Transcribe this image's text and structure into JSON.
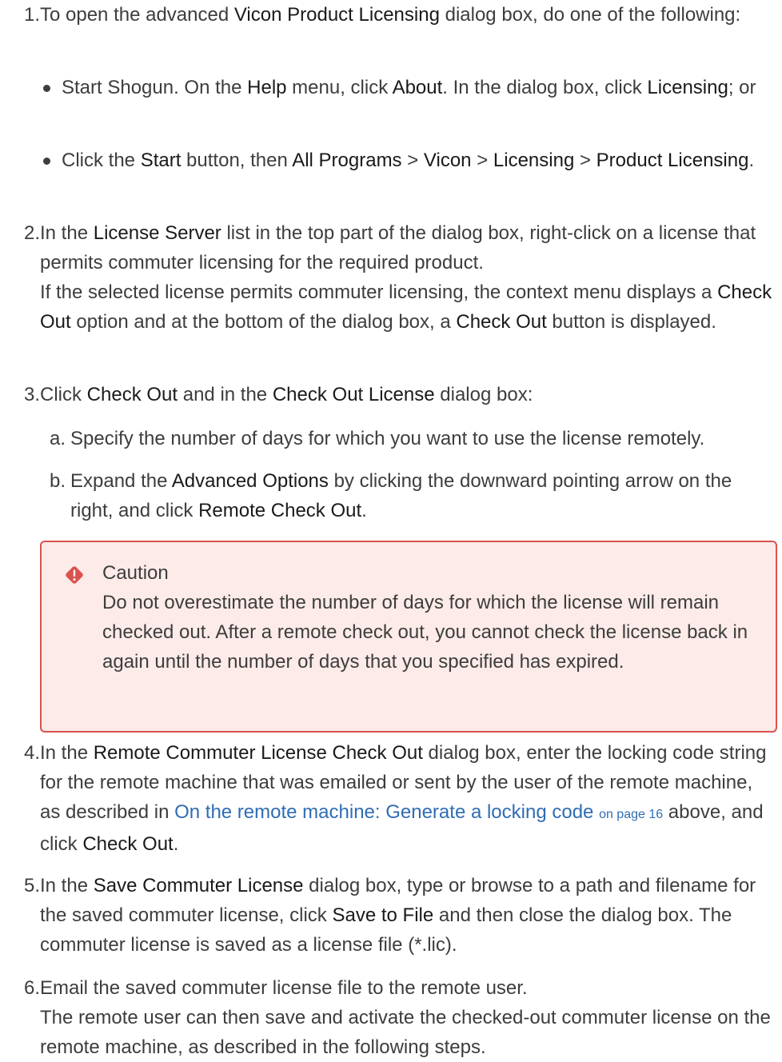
{
  "steps": [
    {
      "num": "1.",
      "parts": [
        "To open the advanced ",
        {
          "b": "Vicon Product Licensing"
        },
        " dialog box, do one of the following:"
      ]
    },
    {
      "num": "2.",
      "parts": [
        "In the ",
        {
          "b": "License Server"
        },
        " list in the top part of the dialog box, right-click on a license that permits commuter licensing for the required product.",
        {
          "br": true
        },
        "If the selected license permits commuter licensing, the context menu displays a ",
        {
          "b": "Check Out"
        },
        " option and at the bottom of the dialog box, a ",
        {
          "b": "Check Out"
        },
        " button is displayed."
      ]
    },
    {
      "num": "3.",
      "parts": [
        "Click ",
        {
          "b": "Check Out"
        },
        " and in the ",
        {
          "b": "Check Out License"
        },
        " dialog box:"
      ]
    },
    {
      "num": "4.",
      "parts": [
        "In the ",
        {
          "b": "Remote Commuter License Check Out"
        },
        " dialog box, enter the locking code string for the remote machine that was emailed or sent by the user of the remote machine, as described in ",
        {
          "link": "On the remote machine: Generate a locking code",
          "small": "on page 16"
        },
        " above, and click ",
        {
          "b": "Check Out"
        },
        "."
      ]
    },
    {
      "num": "5.",
      "parts": [
        "In the ",
        {
          "b": "Save Commuter License"
        },
        " dialog box, type or browse to a path and filename for the saved commuter license, click ",
        {
          "b": "Save to File"
        },
        " and then close the dialog box. The commuter license is saved as a license file (*.lic)."
      ]
    },
    {
      "num": "6.",
      "parts": [
        "Email the saved commuter license file to the remote user.",
        {
          "br": true
        },
        "The remote user can then save and activate the checked-out commuter license on the remote machine, as described in the following steps."
      ]
    }
  ],
  "bullets": [
    {
      "parts": [
        "Start Shogun. On the ",
        {
          "b": "Help"
        },
        " menu, click ",
        {
          "b": "About"
        },
        ". In the dialog box, click ",
        {
          "b": "Licensing"
        },
        "; or"
      ]
    },
    {
      "parts": [
        "Click the ",
        {
          "b": "Start"
        },
        " button, then ",
        {
          "b": "All Programs"
        },
        " > ",
        {
          "b": "Vicon"
        },
        " > ",
        {
          "b": "Licensing"
        },
        " > ",
        {
          "b": "Product Licensing"
        },
        "."
      ]
    }
  ],
  "substeps": [
    {
      "label": "a.",
      "parts": [
        "Specify the number of days for which you want to use the license remotely."
      ]
    },
    {
      "label": "b.",
      "parts": [
        "Expand the ",
        {
          "b": "Advanced Options"
        },
        " by clicking the downward pointing arrow on the right, and click ",
        {
          "b": "Remote Check Out"
        },
        "."
      ]
    }
  ],
  "caution": {
    "title": "Caution",
    "text": "Do not overestimate the number of days for which the license will remain checked out. After a remote check out, you cannot check the license back in again until the number of days that you specified has expired.",
    "icon": "warning-diamond-icon",
    "border_color": "#d9534f",
    "background_color": "#fcebe8"
  }
}
